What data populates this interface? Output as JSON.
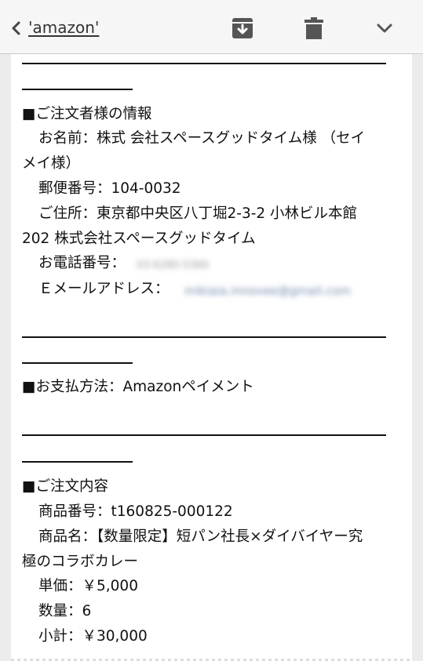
{
  "nav": {
    "title": "'amazon'",
    "back_icon": "chevron-left-icon",
    "archive_icon": "archive-icon",
    "trash_icon": "trash-icon",
    "more_icon": "chevron-down-icon"
  },
  "email": {
    "orderer": {
      "heading": "■ご注文者様の情報",
      "name_line1": "お名前：株式 会社スペースグッドタイム様 （セイ",
      "name_line2": "メイ様）",
      "postal": "郵便番号：104-0032",
      "address_line1": "ご住所：東京都中央区八丁堀2-3-2 小林ビル本館",
      "address_line2": "202 株式会社スペースグッドタイム",
      "phone_label": "お電話番号：",
      "phone_value": "03-6280-5366",
      "email_label": "Ｅメールアドレス：",
      "email_value": "mikiaia.innovee@gmail.com"
    },
    "payment": {
      "heading": "■お支払方法：Amazonペイメント"
    },
    "order": {
      "heading": "■ご注文内容",
      "product_no": "商品番号：t160825-000122",
      "product_name_line1": "商品名：【数量限定】短パン社長×ダイバイヤー究",
      "product_name_line2": "極のコラボカレー",
      "unit_price": "単価：￥5,000",
      "quantity": "数量：6",
      "subtotal": "小計：￥30,000"
    }
  }
}
